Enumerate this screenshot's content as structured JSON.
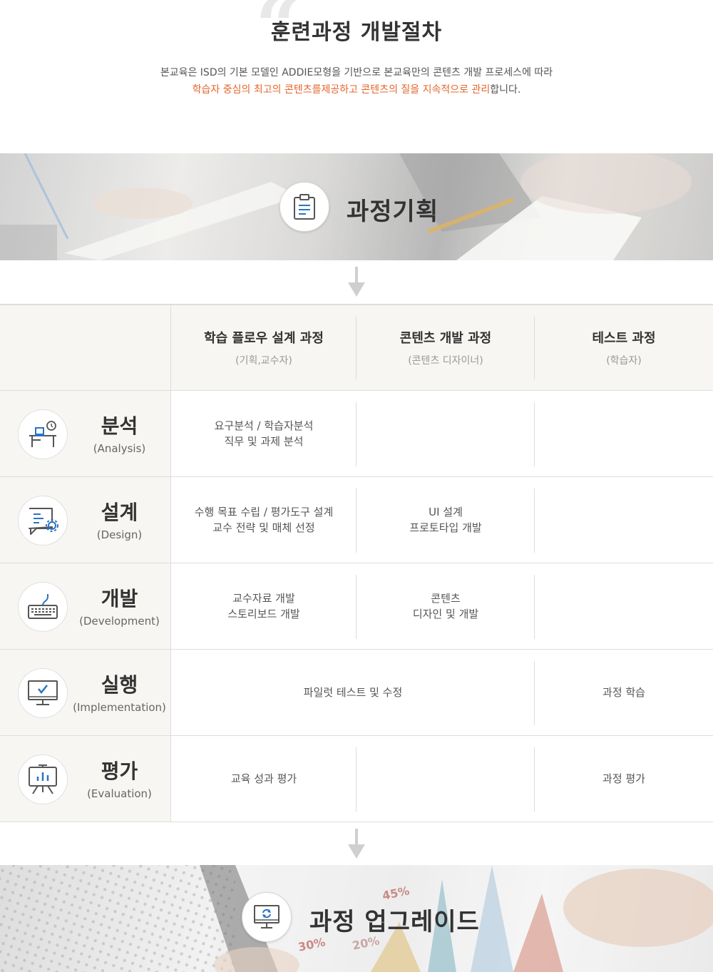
{
  "header": {
    "quote_glyph": "“",
    "title": "훈련과정 개발절차",
    "intro_line1": "본교육은 ISD의 기본 모델인 ADDIE모형을 기반으로 본교육만의 콘텐츠 개발 프로세스에 따라",
    "intro_line2_highlight": "학습자 중심의 최고의 콘텐츠를제공하고 콘텐츠의 질을 지속적으로 관리",
    "intro_line2_tail": "합니다."
  },
  "banner_top": {
    "title": "과정기획",
    "icon": "clipboard-icon"
  },
  "banner_bottom": {
    "title": "과정 업그레이드",
    "icon": "monitor-refresh-icon",
    "photo_labels": [
      "45%",
      "30%",
      "20%"
    ]
  },
  "columns": [
    {
      "title": "학습 플로우 설계 과정",
      "sub": "(기획,교수자)"
    },
    {
      "title": "콘텐츠 개발 과정",
      "sub": "(콘텐츠 디자이너)"
    },
    {
      "title": "테스트 과정",
      "sub": "(학습자)"
    }
  ],
  "rows": [
    {
      "name": "분석",
      "sub": "(Analysis)",
      "icon": "desk-clock-icon",
      "cells": [
        "요구분석 / 학습자분석\n직무 및 과제 분석",
        "",
        ""
      ]
    },
    {
      "name": "설계",
      "sub": "(Design)",
      "icon": "document-gear-icon",
      "cells": [
        "수행 목표 수립 / 평가도구 설계\n교수 전략 및 매체 선정",
        "UI 설계\n프로토타입 개발",
        ""
      ]
    },
    {
      "name": "개발",
      "sub": "(Development)",
      "icon": "keyboard-icon",
      "cells": [
        "교수자료 개발\n스토리보드 개발",
        "콘텐츠\n디자인 및 개발",
        ""
      ]
    },
    {
      "name": "실행",
      "sub": "(Implementation)",
      "icon": "monitor-check-icon",
      "cells": [
        "파일럿 테스트 및 수정",
        "과정 학습"
      ]
    },
    {
      "name": "평가",
      "sub": "(Evaluation)",
      "icon": "presentation-chart-icon",
      "cells": [
        "교육 성과 평가",
        "",
        "과정 평가"
      ]
    }
  ],
  "colors": {
    "accent": "#e5652a",
    "icon_blue": "#2b73c4",
    "icon_stroke": "#555555"
  }
}
